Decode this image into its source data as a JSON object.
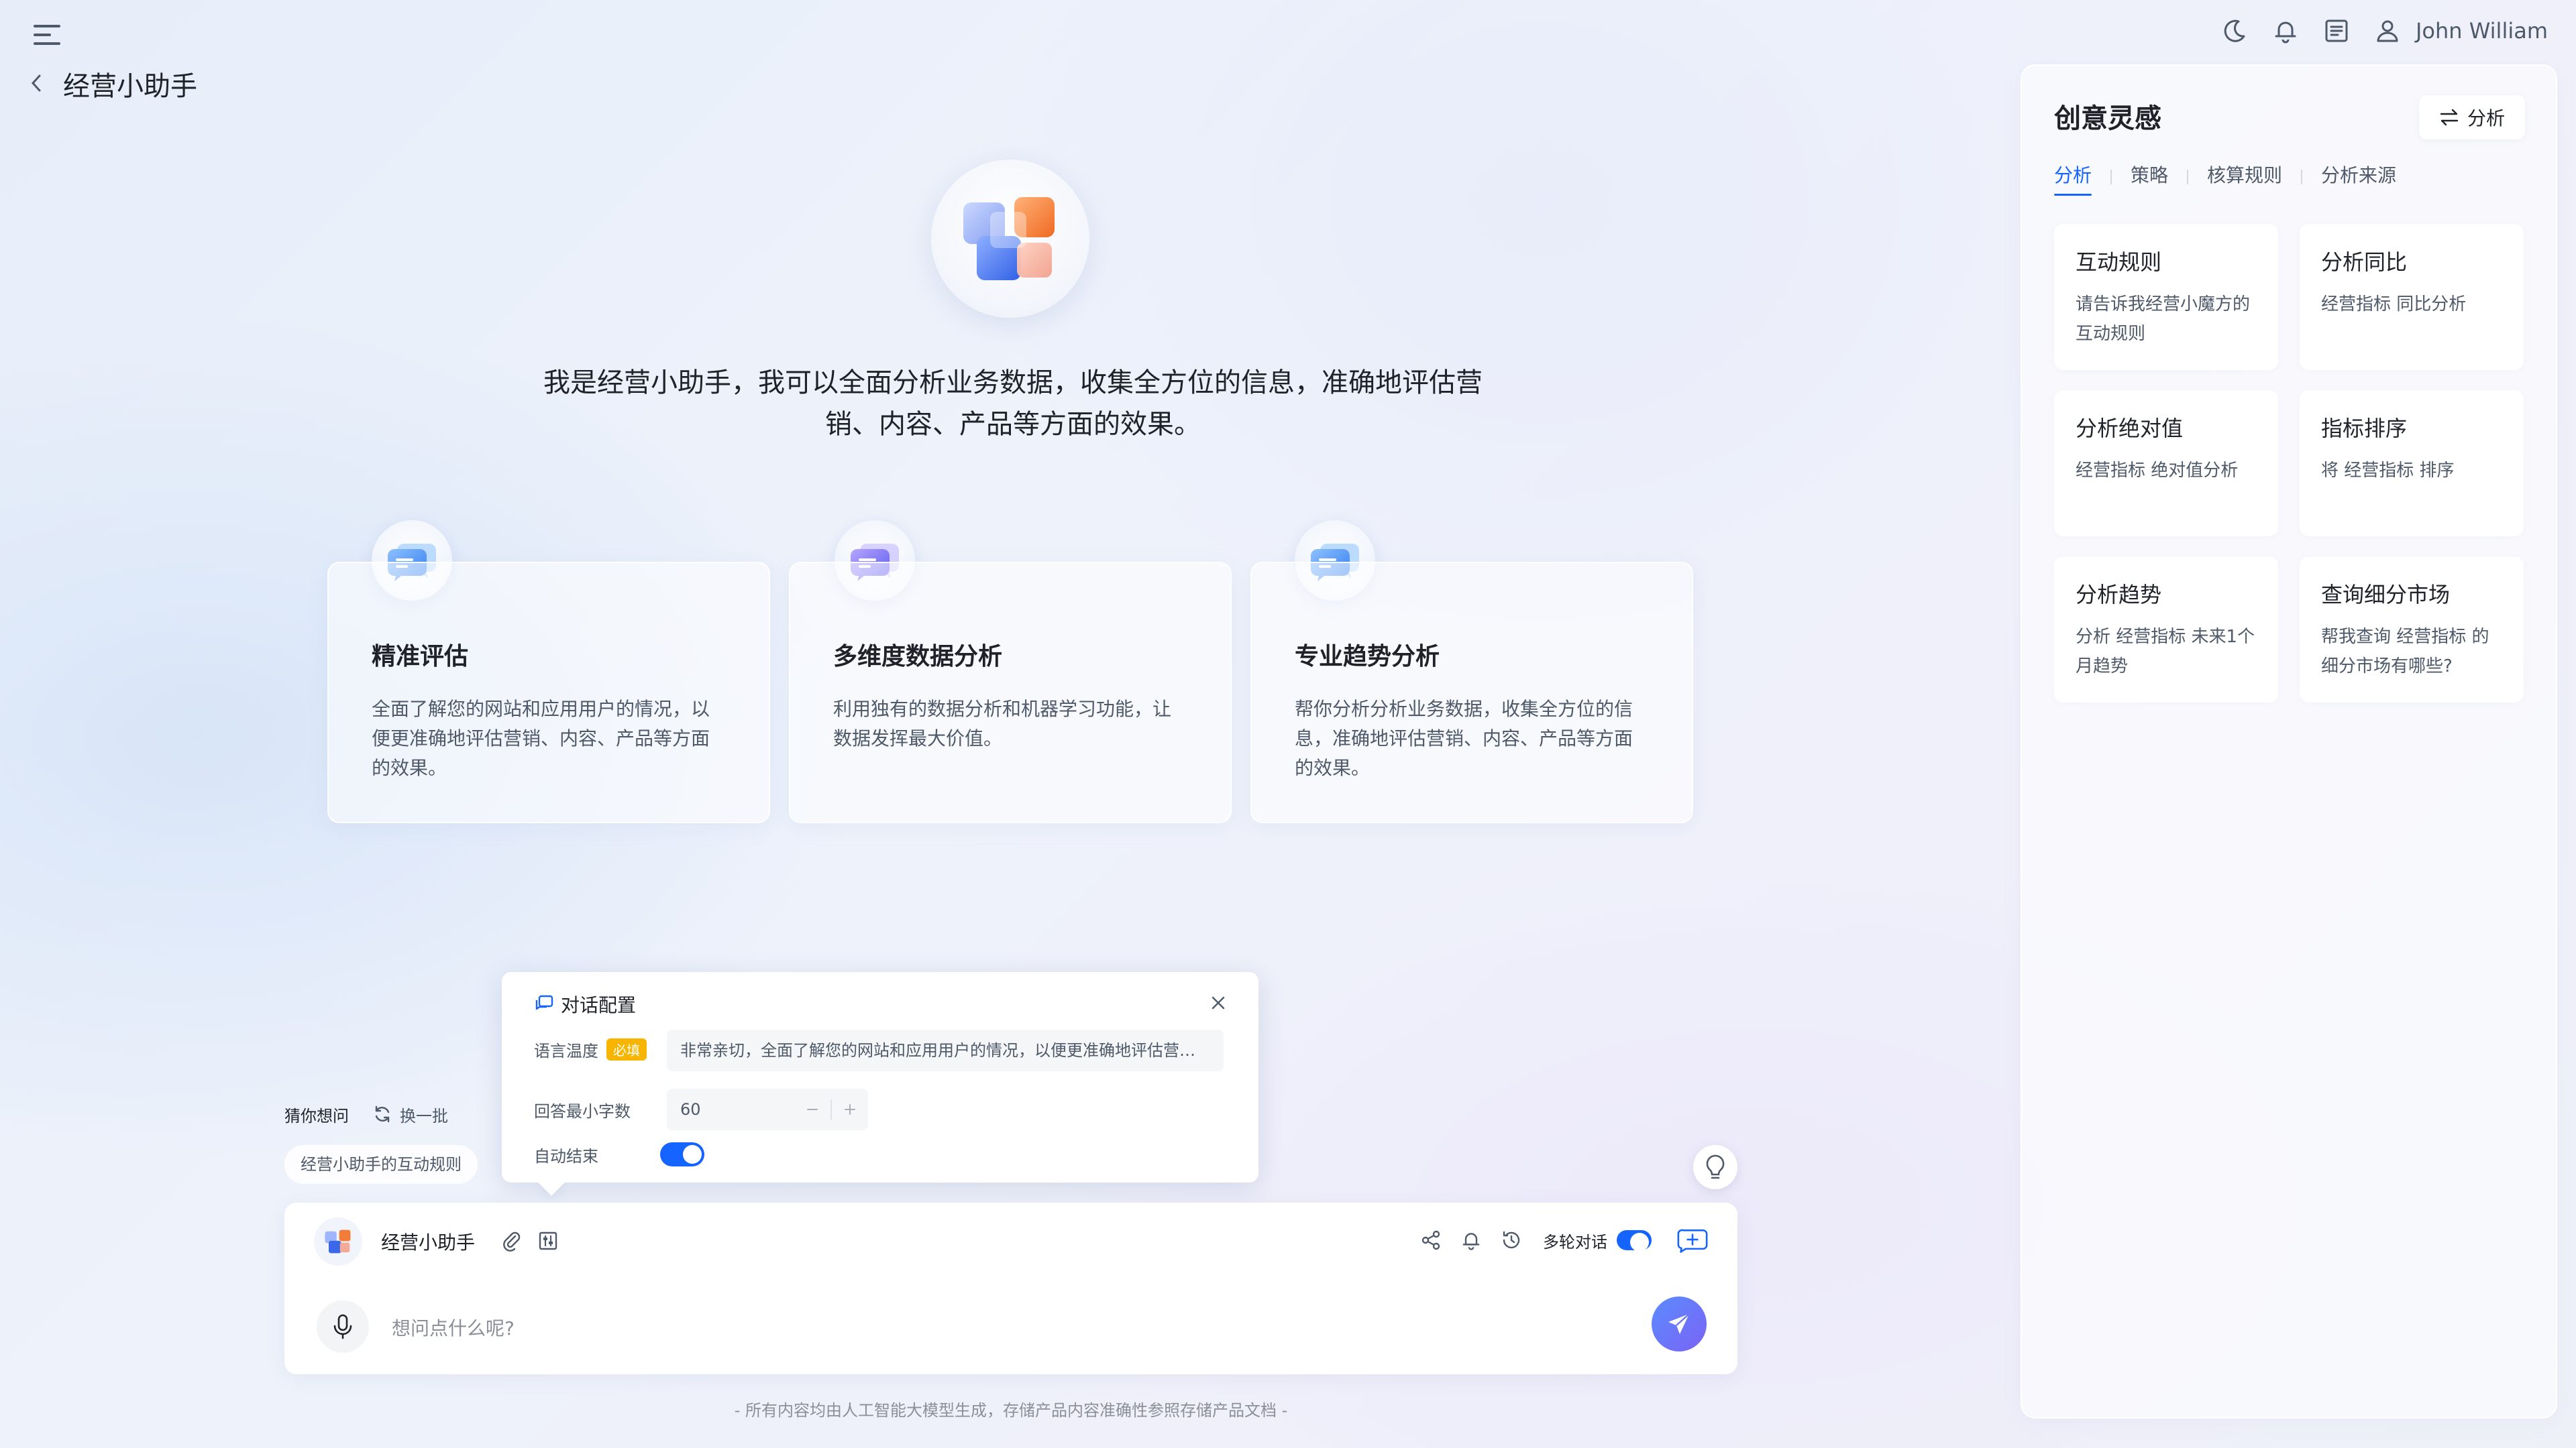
{
  "header": {
    "page_title": "经营小助手",
    "user_name": "John William"
  },
  "hero": {
    "intro_text": "我是经营小助手，我可以全面分析业务数据，收集全方位的信息，准确地评估营销、内容、产品等方面的效果。"
  },
  "features": [
    {
      "title": "精准评估",
      "desc": "全面了解您的网站和应用用户的情况，以便更准确地评估营销、内容、产品等方面的效果。",
      "icon": "chat-bubble-icon"
    },
    {
      "title": "多维度数据分析",
      "desc": "利用独有的数据分析和机器学习功能，让数据发挥最大价值。",
      "icon": "chat-bubble-icon"
    },
    {
      "title": "专业趋势分析",
      "desc": "帮你分析分析业务数据，收集全方位的信息，准确地评估营销、内容、产品等方面的效果。",
      "icon": "chat-bubble-icon"
    }
  ],
  "config": {
    "title": "对话配置",
    "tone_label": "语言温度",
    "required_badge": "必填",
    "tone_value": "非常亲切，全面了解您的网站和应用用户的情况，以便更准确地评估营销...",
    "min_words_label": "回答最小字数",
    "min_words_value": "60",
    "auto_end_label": "自动结束",
    "auto_end_on": true
  },
  "suggestions": {
    "label": "猜你想问",
    "refresh_label": "换一批",
    "items": [
      "经营小助手的互动规则"
    ]
  },
  "chat": {
    "agent_name": "经营小助手",
    "multi_turn_label": "多轮对话",
    "multi_turn_on": true,
    "placeholder": "想问点什么呢?"
  },
  "footer": {
    "disclaimer": "- 所有内容均由人工智能大模型生成，存储产品内容准确性参照存储产品文档 -"
  },
  "panel": {
    "title": "创意灵感",
    "action_label": "分析",
    "tabs": [
      "分析",
      "策略",
      "核算规则",
      "分析来源"
    ],
    "active_tab": 0,
    "cards": [
      {
        "title": "互动规则",
        "desc": "请告诉我经营小魔方的互动规则"
      },
      {
        "title": "分析同比",
        "desc": "经营指标 同比分析"
      },
      {
        "title": "分析绝对值",
        "desc": "经营指标 绝对值分析"
      },
      {
        "title": "指标排序",
        "desc": "将 经营指标 排序"
      },
      {
        "title": "分析趋势",
        "desc": "分析 经营指标 未来1个月趋势"
      },
      {
        "title": "查询细分市场",
        "desc": "帮我查询 经营指标 的细分市场有哪些?"
      }
    ]
  },
  "colors": {
    "accent": "#1664ff",
    "badge": "#f7b500",
    "send_gradient_start": "#5b8cff",
    "send_gradient_end": "#7a63f5"
  }
}
